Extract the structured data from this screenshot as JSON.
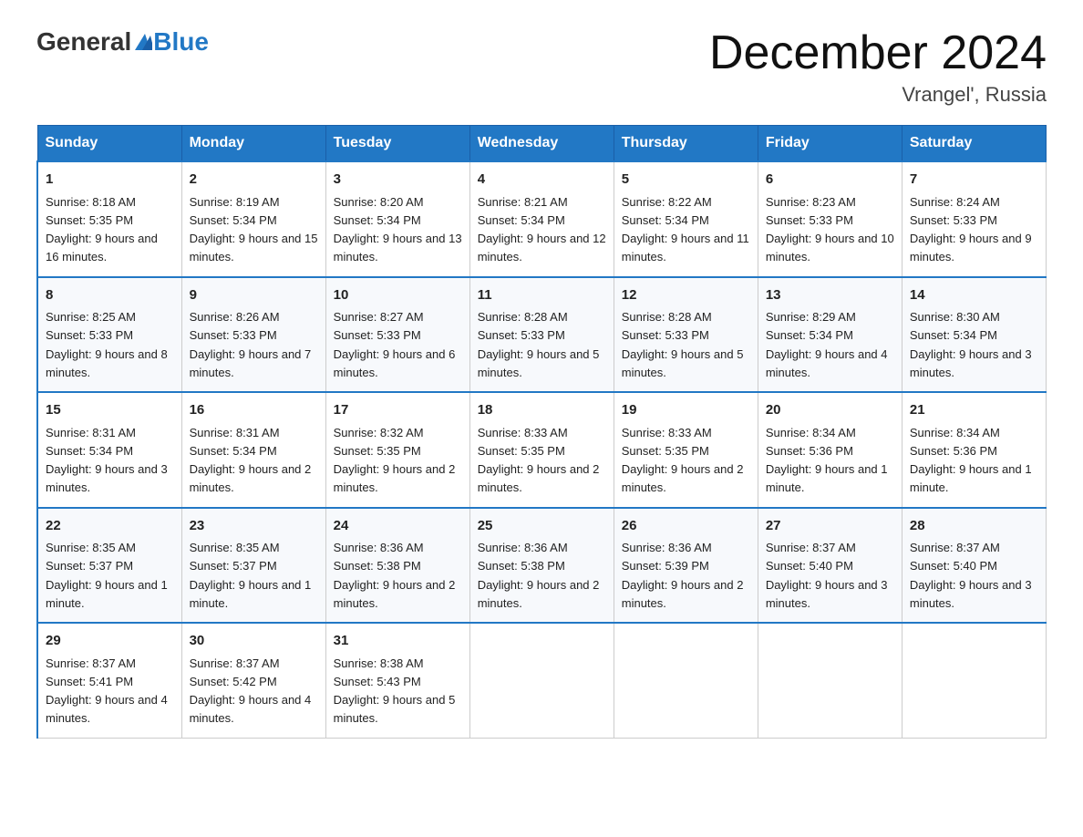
{
  "header": {
    "logo_general": "General",
    "logo_blue": "Blue",
    "month_title": "December 2024",
    "location": "Vrangel', Russia"
  },
  "days_of_week": [
    "Sunday",
    "Monday",
    "Tuesday",
    "Wednesday",
    "Thursday",
    "Friday",
    "Saturday"
  ],
  "weeks": [
    [
      {
        "day": "1",
        "sunrise": "8:18 AM",
        "sunset": "5:35 PM",
        "daylight": "9 hours and 16 minutes."
      },
      {
        "day": "2",
        "sunrise": "8:19 AM",
        "sunset": "5:34 PM",
        "daylight": "9 hours and 15 minutes."
      },
      {
        "day": "3",
        "sunrise": "8:20 AM",
        "sunset": "5:34 PM",
        "daylight": "9 hours and 13 minutes."
      },
      {
        "day": "4",
        "sunrise": "8:21 AM",
        "sunset": "5:34 PM",
        "daylight": "9 hours and 12 minutes."
      },
      {
        "day": "5",
        "sunrise": "8:22 AM",
        "sunset": "5:34 PM",
        "daylight": "9 hours and 11 minutes."
      },
      {
        "day": "6",
        "sunrise": "8:23 AM",
        "sunset": "5:33 PM",
        "daylight": "9 hours and 10 minutes."
      },
      {
        "day": "7",
        "sunrise": "8:24 AM",
        "sunset": "5:33 PM",
        "daylight": "9 hours and 9 minutes."
      }
    ],
    [
      {
        "day": "8",
        "sunrise": "8:25 AM",
        "sunset": "5:33 PM",
        "daylight": "9 hours and 8 minutes."
      },
      {
        "day": "9",
        "sunrise": "8:26 AM",
        "sunset": "5:33 PM",
        "daylight": "9 hours and 7 minutes."
      },
      {
        "day": "10",
        "sunrise": "8:27 AM",
        "sunset": "5:33 PM",
        "daylight": "9 hours and 6 minutes."
      },
      {
        "day": "11",
        "sunrise": "8:28 AM",
        "sunset": "5:33 PM",
        "daylight": "9 hours and 5 minutes."
      },
      {
        "day": "12",
        "sunrise": "8:28 AM",
        "sunset": "5:33 PM",
        "daylight": "9 hours and 5 minutes."
      },
      {
        "day": "13",
        "sunrise": "8:29 AM",
        "sunset": "5:34 PM",
        "daylight": "9 hours and 4 minutes."
      },
      {
        "day": "14",
        "sunrise": "8:30 AM",
        "sunset": "5:34 PM",
        "daylight": "9 hours and 3 minutes."
      }
    ],
    [
      {
        "day": "15",
        "sunrise": "8:31 AM",
        "sunset": "5:34 PM",
        "daylight": "9 hours and 3 minutes."
      },
      {
        "day": "16",
        "sunrise": "8:31 AM",
        "sunset": "5:34 PM",
        "daylight": "9 hours and 2 minutes."
      },
      {
        "day": "17",
        "sunrise": "8:32 AM",
        "sunset": "5:35 PM",
        "daylight": "9 hours and 2 minutes."
      },
      {
        "day": "18",
        "sunrise": "8:33 AM",
        "sunset": "5:35 PM",
        "daylight": "9 hours and 2 minutes."
      },
      {
        "day": "19",
        "sunrise": "8:33 AM",
        "sunset": "5:35 PM",
        "daylight": "9 hours and 2 minutes."
      },
      {
        "day": "20",
        "sunrise": "8:34 AM",
        "sunset": "5:36 PM",
        "daylight": "9 hours and 1 minute."
      },
      {
        "day": "21",
        "sunrise": "8:34 AM",
        "sunset": "5:36 PM",
        "daylight": "9 hours and 1 minute."
      }
    ],
    [
      {
        "day": "22",
        "sunrise": "8:35 AM",
        "sunset": "5:37 PM",
        "daylight": "9 hours and 1 minute."
      },
      {
        "day": "23",
        "sunrise": "8:35 AM",
        "sunset": "5:37 PM",
        "daylight": "9 hours and 1 minute."
      },
      {
        "day": "24",
        "sunrise": "8:36 AM",
        "sunset": "5:38 PM",
        "daylight": "9 hours and 2 minutes."
      },
      {
        "day": "25",
        "sunrise": "8:36 AM",
        "sunset": "5:38 PM",
        "daylight": "9 hours and 2 minutes."
      },
      {
        "day": "26",
        "sunrise": "8:36 AM",
        "sunset": "5:39 PM",
        "daylight": "9 hours and 2 minutes."
      },
      {
        "day": "27",
        "sunrise": "8:37 AM",
        "sunset": "5:40 PM",
        "daylight": "9 hours and 3 minutes."
      },
      {
        "day": "28",
        "sunrise": "8:37 AM",
        "sunset": "5:40 PM",
        "daylight": "9 hours and 3 minutes."
      }
    ],
    [
      {
        "day": "29",
        "sunrise": "8:37 AM",
        "sunset": "5:41 PM",
        "daylight": "9 hours and 4 minutes."
      },
      {
        "day": "30",
        "sunrise": "8:37 AM",
        "sunset": "5:42 PM",
        "daylight": "9 hours and 4 minutes."
      },
      {
        "day": "31",
        "sunrise": "8:38 AM",
        "sunset": "5:43 PM",
        "daylight": "9 hours and 5 minutes."
      },
      null,
      null,
      null,
      null
    ]
  ],
  "labels": {
    "sunrise": "Sunrise:",
    "sunset": "Sunset:",
    "daylight": "Daylight:"
  }
}
